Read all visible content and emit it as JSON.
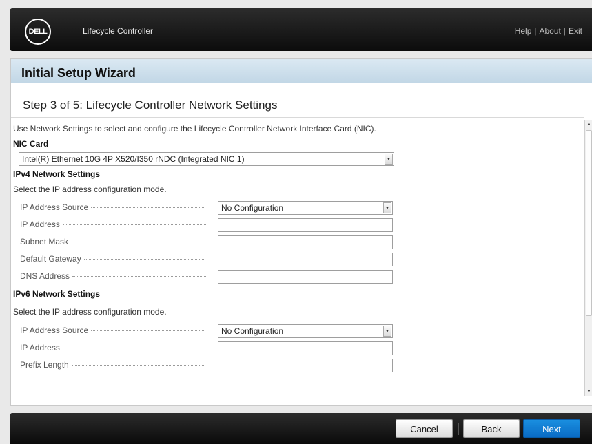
{
  "header": {
    "logo_text": "DELL",
    "app_title": "Lifecycle Controller",
    "links": {
      "help": "Help",
      "about": "About",
      "exit": "Exit",
      "separator": "|"
    }
  },
  "wizard": {
    "title": "Initial Setup Wizard",
    "step_title": "Step 3 of 5: Lifecycle Controller Network Settings",
    "intro": "Use Network Settings to select and configure the Lifecycle Controller Network Interface Card (NIC)."
  },
  "nic": {
    "heading": "NIC Card",
    "selected": "Intel(R) Ethernet 10G 4P X520/I350 rNDC (Integrated NIC 1)"
  },
  "ipv4": {
    "heading": "IPv4 Network Settings",
    "hint": "Select the IP address configuration mode.",
    "source_label": "IP Address Source",
    "source_value": "No Configuration",
    "ip_label": "IP Address",
    "ip_value": "",
    "subnet_label": "Subnet Mask",
    "subnet_value": "",
    "gateway_label": "Default Gateway",
    "gateway_value": "",
    "dns_label": "DNS Address",
    "dns_value": ""
  },
  "ipv6": {
    "heading": "IPv6 Network Settings",
    "hint": "Select the IP address configuration mode.",
    "source_label": "IP Address Source",
    "source_value": "No Configuration",
    "ip_label": "IP Address",
    "ip_value": "",
    "prefix_label": "Prefix Length",
    "prefix_value": ""
  },
  "footer": {
    "cancel": "Cancel",
    "back": "Back",
    "next": "Next"
  },
  "icons": {
    "dropdown": "chevron-down-icon",
    "scroll_up": "arrow-up-icon",
    "scroll_down": "arrow-down-icon"
  },
  "colors": {
    "primary_button": "#0a6bc4",
    "header_band": "#c2d7e6"
  }
}
